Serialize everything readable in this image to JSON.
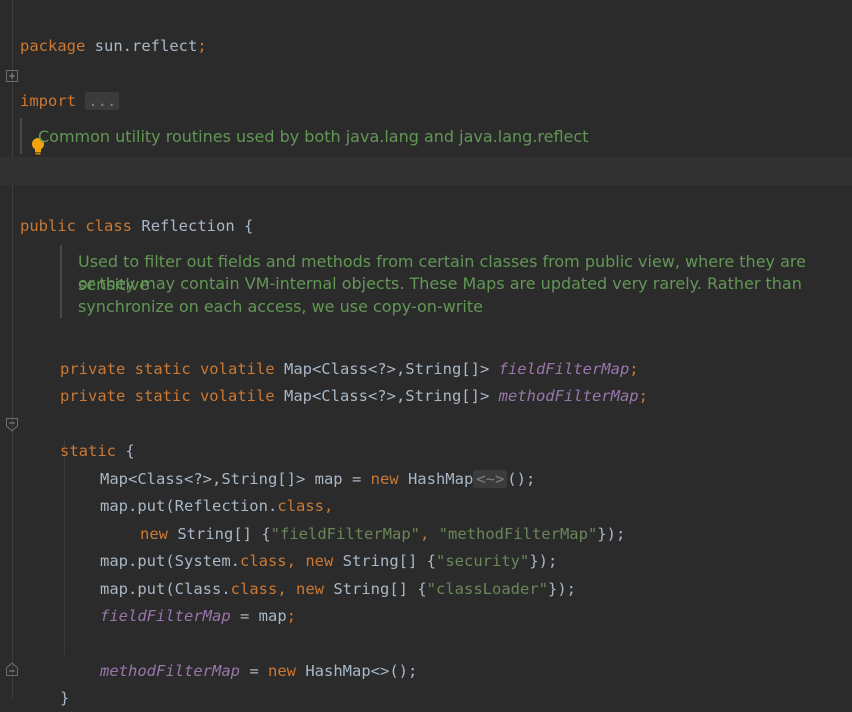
{
  "editor": {
    "package_line": {
      "keyword": "package",
      "name": "sun.reflect",
      "semi": ";"
    },
    "import_line": {
      "keyword": "import",
      "folded": "..."
    },
    "class_doc": "Common utility routines used by both java.lang and java.lang.reflect",
    "class_decl": {
      "kw_public": "public",
      "kw_class": "class",
      "name": "Reflection",
      "brace": "{"
    },
    "field_doc": [
      "Used to filter out fields and methods from certain classes from public view, where they are sensitive",
      "or they may contain VM-internal objects. These Maps are updated very rarely. Rather than",
      "synchronize on each access, we use copy-on-write"
    ],
    "field1": {
      "mods": "private static volatile",
      "type": "Map<Class<?>,String[]>",
      "name": "fieldFilterMap",
      "semi": ";"
    },
    "field2": {
      "mods": "private static volatile",
      "type": "Map<Class<?>,String[]>",
      "name": "methodFilterMap",
      "semi": ";"
    },
    "static_block": {
      "kw": "static",
      "brace": "{",
      "line1": {
        "type": "Map<Class<?>,String[]> map = ",
        "kw_new": "new",
        "ctor": "HashMap",
        "diamond": "<~>",
        "tail": "();"
      },
      "line2": {
        "prefix": "map.put(Reflection.",
        "kw_class": "class",
        "comma": ","
      },
      "line3": {
        "kw_new": "new",
        "type": "String[] {",
        "s1": "\"fieldFilterMap\"",
        "sep": ", ",
        "s2": "\"methodFilterMap\"",
        "tail": "});"
      },
      "line4": {
        "prefix": "map.put(System.",
        "kw_class": "class",
        "comma": ", ",
        "kw_new": "new",
        "type": "String[] {",
        "s1": "\"security\"",
        "tail": "});"
      },
      "line5": {
        "prefix": "map.put(Class.",
        "kw_class": "class",
        "comma": ", ",
        "kw_new": "new",
        "type": "String[] {",
        "s1": "\"classLoader\"",
        "tail": "});"
      },
      "line6": {
        "field": "fieldFilterMap",
        "assign": " = map",
        "semi": ";"
      },
      "line7": {
        "field": "methodFilterMap",
        "assign": " = ",
        "kw_new": "new",
        "ctor": "HashMap<>();"
      },
      "close": "}"
    }
  }
}
